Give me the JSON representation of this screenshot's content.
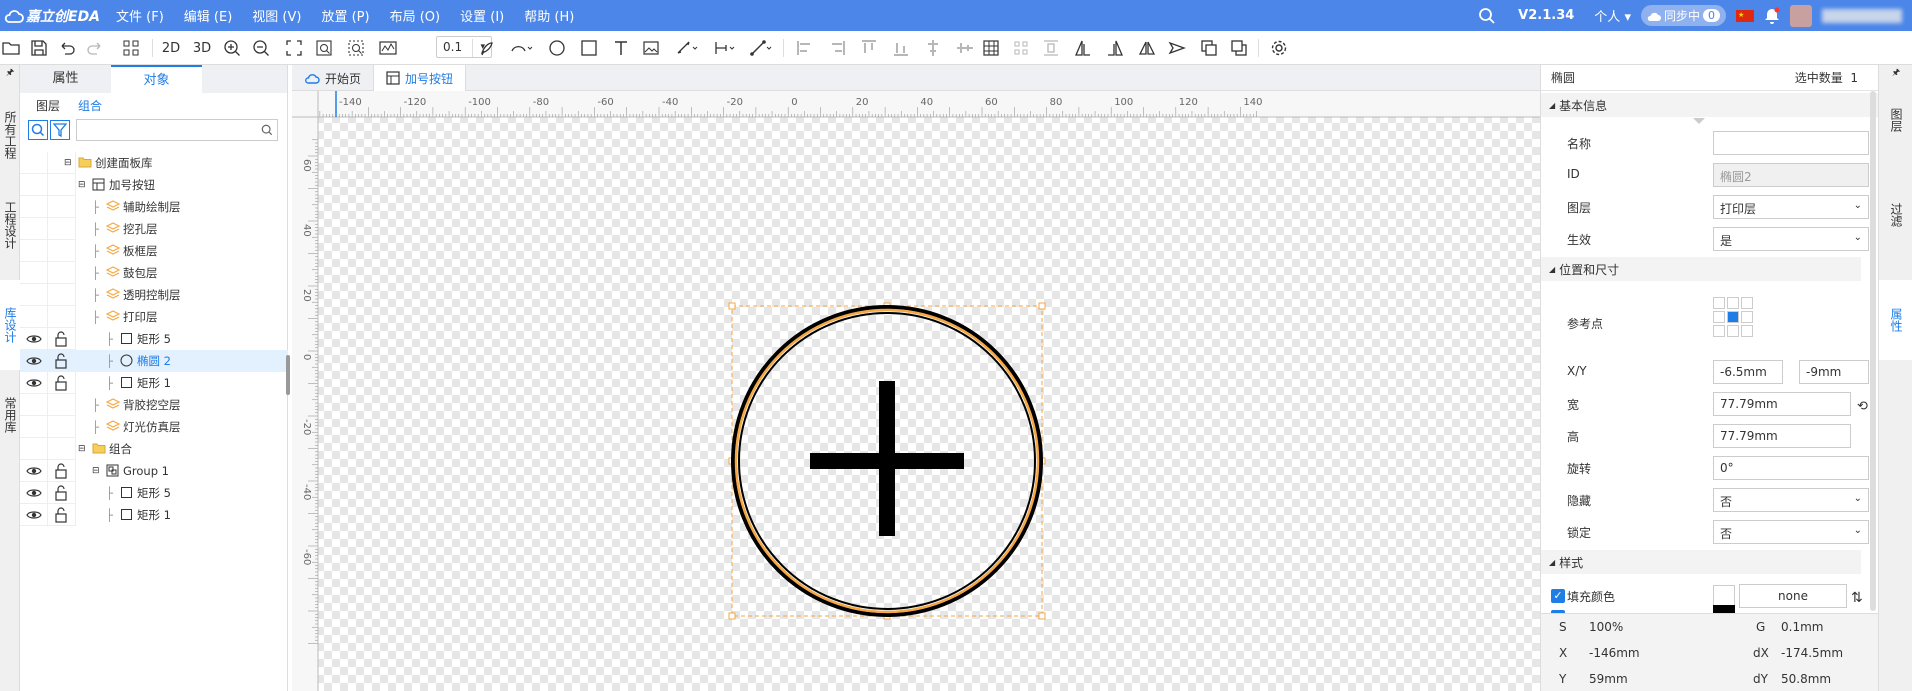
{
  "app": {
    "logo_text": "嘉立创EDA",
    "menus": [
      "文件 (F)",
      "编辑 (E)",
      "视图 (V)",
      "放置 (P)",
      "布局 (O)",
      "设置 (I)",
      "帮助 (H)"
    ],
    "version": "V2.1.34",
    "user_scope": "个人",
    "sync_label": "同步中",
    "sync_count": "0"
  },
  "toolbar": {
    "zoom_value": "0.1",
    "view_2d": "2D",
    "view_3d": "3D"
  },
  "left_vtabs": [
    "所有工程",
    "工程设计",
    "库设计",
    "常用库"
  ],
  "left_panel": {
    "tabs": [
      "属性",
      "对象"
    ],
    "active_tab": "对象",
    "sub_tabs": [
      "图层",
      "组合"
    ],
    "search_placeholder": "",
    "tree": [
      {
        "label": "创建面板库",
        "type": "folder"
      },
      {
        "label": "加号按钮",
        "type": "board"
      },
      {
        "label": "辅助绘制层",
        "type": "layer"
      },
      {
        "label": "挖孔层",
        "type": "layer"
      },
      {
        "label": "板框层",
        "type": "layer"
      },
      {
        "label": "鼓包层",
        "type": "layer"
      },
      {
        "label": "透明控制层",
        "type": "layer"
      },
      {
        "label": "打印层",
        "type": "layer"
      },
      {
        "label": "矩形 5",
        "type": "rect"
      },
      {
        "label": "椭圆 2",
        "type": "ellipse"
      },
      {
        "label": "矩形 1",
        "type": "rect"
      },
      {
        "label": "背胶挖空层",
        "type": "layer"
      },
      {
        "label": "灯光仿真层",
        "type": "layer"
      },
      {
        "label": "组合",
        "type": "folder"
      },
      {
        "label": "Group 1",
        "type": "group"
      },
      {
        "label": "矩形 5",
        "type": "rect"
      },
      {
        "label": "矩形 1",
        "type": "rect"
      }
    ]
  },
  "doc_tabs": [
    "开始页",
    "加号按钮"
  ],
  "ruler": {
    "h_labels": [
      "-140",
      "-120",
      "-100",
      "-80",
      "-60",
      "-40",
      "-20",
      "0",
      "20",
      "40",
      "60",
      "80",
      "100",
      "120",
      "140"
    ],
    "v_labels": [
      "60",
      "40",
      "20",
      "0",
      "-20",
      "-40",
      "-60"
    ]
  },
  "right_panel": {
    "object_type": "椭圆",
    "selected_label": "选中数量",
    "selected_count": "1",
    "basic_section": "基本信息",
    "name_label": "名称",
    "name_value": "",
    "id_label": "ID",
    "id_value": "椭圆2",
    "layer_label": "图层",
    "layer_value": "打印层",
    "effective_label": "生效",
    "effective_value": "是",
    "pos_section": "位置和尺寸",
    "ref_label": "参考点",
    "xy_label": "X/Y",
    "x_value": "-6.5mm",
    "y_value": "-9mm",
    "width_label": "宽",
    "width_value": "77.79mm",
    "height_label": "高",
    "height_value": "77.79mm",
    "rotation_label": "旋转",
    "rotation_value": "0°",
    "hidden_label": "隐藏",
    "hidden_value": "否",
    "lock_label": "锁定",
    "lock_value": "否",
    "style_section": "样式",
    "fill_label": "填充颜色",
    "fill_value": "none",
    "stroke_color": "#000000"
  },
  "status": {
    "s_label": "S",
    "s_value": "100%",
    "g_label": "G",
    "g_value": "0.1mm",
    "x_label": "X",
    "x_value": "-146mm",
    "dx_label": "dX",
    "dx_value": "-174.5mm",
    "y_label": "Y",
    "y_value": "59mm",
    "dy_label": "dY",
    "dy_value": "50.8mm"
  },
  "right_vtabs": [
    "图层",
    "过滤",
    "属性"
  ],
  "colors": {
    "menubar": "#4b86e8",
    "accent": "#1f7de6",
    "selection": "#f5a742"
  }
}
